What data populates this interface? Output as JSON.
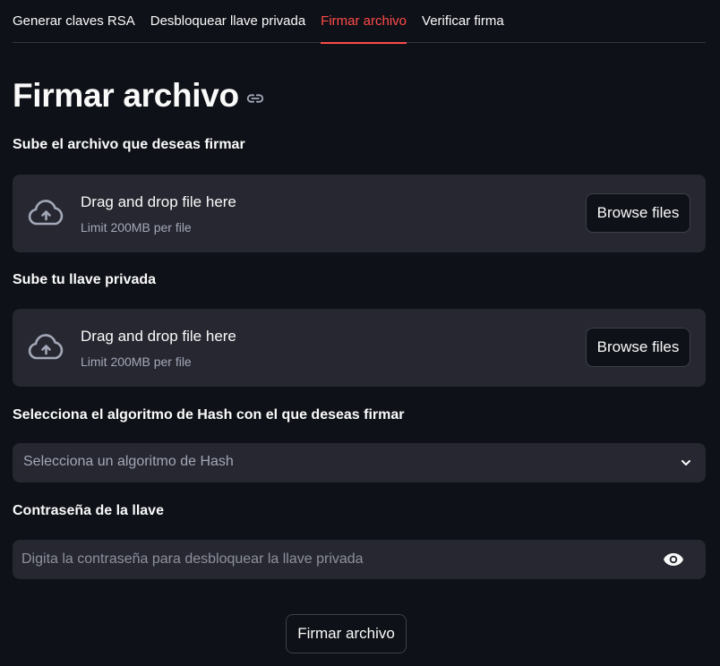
{
  "tabs": [
    {
      "label": "Generar claves RSA",
      "active": false
    },
    {
      "label": "Desbloquear llave privada",
      "active": false
    },
    {
      "label": "Firmar archivo",
      "active": true
    },
    {
      "label": "Verificar firma",
      "active": false
    }
  ],
  "page": {
    "title": "Firmar archivo",
    "title_link_icon": "link-icon"
  },
  "file_upload": {
    "label": "Sube el archivo que deseas firmar",
    "dropzone_text": "Drag and drop file here",
    "limit_text": "Limit 200MB per file",
    "browse_label": "Browse files",
    "icon": "cloud-upload-icon"
  },
  "key_upload": {
    "label": "Sube tu llave privada",
    "dropzone_text": "Drag and drop file here",
    "limit_text": "Limit 200MB per file",
    "browse_label": "Browse files",
    "icon": "cloud-upload-icon"
  },
  "hash_select": {
    "label": "Selecciona el algoritmo de Hash con el que deseas firmar",
    "placeholder": "Selecciona un algoritmo de Hash",
    "icon": "chevron-down-icon"
  },
  "password": {
    "label": "Contraseña de la llave",
    "placeholder": "Digita la contraseña para desbloquear la llave privada",
    "value": "",
    "icon": "eye-icon"
  },
  "submit": {
    "label": "Firmar archivo"
  },
  "colors": {
    "background": "#0e1117",
    "surface": "#262730",
    "accent": "#ff4b4b",
    "text": "#fafafa",
    "muted_text": "#a3a8b8"
  }
}
